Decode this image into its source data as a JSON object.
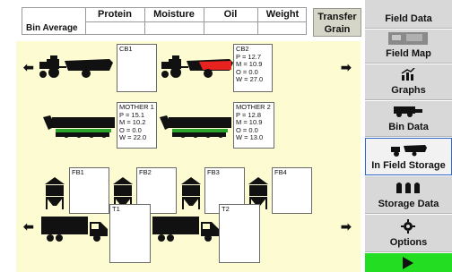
{
  "bin_average": {
    "headers": [
      "Protein",
      "Moisture",
      "Oil",
      "Weight"
    ],
    "row_label": "Bin Average",
    "values": [
      "",
      "",
      "",
      ""
    ]
  },
  "transfer_button": {
    "line1": "Transfer",
    "line2": "Grain"
  },
  "arrows": {
    "left": "⬅",
    "right": "➡"
  },
  "grain_carts": [
    {
      "name": "CB1",
      "lines": [
        "",
        "",
        "",
        ""
      ]
    },
    {
      "name": "CB2",
      "lines": [
        "P = 12.7",
        "M = 10.9",
        "O = 0.0",
        "W = 27.0"
      ]
    }
  ],
  "mother_bins": [
    {
      "name": "MOTHER 1",
      "lines": [
        "P = 15.1",
        "M = 10.2",
        "O = 0.0",
        "W = 22.0"
      ]
    },
    {
      "name": "MOTHER 2",
      "lines": [
        "P = 12.8",
        "M = 10.9",
        "O = 0.0",
        "W = 13.0"
      ]
    }
  ],
  "field_bins": [
    {
      "name": "FB1"
    },
    {
      "name": "FB2"
    },
    {
      "name": "FB3"
    },
    {
      "name": "FB4"
    }
  ],
  "trucks": [
    {
      "name": "T1"
    },
    {
      "name": "T2"
    }
  ],
  "colors": {
    "cart_filled": "#e8231f",
    "nav_active_border": "#2f68c4",
    "play_button": "#22dd22",
    "storage_bg": "#fdfbd2",
    "mother_stripe": "#2aa52a"
  },
  "sidebar": {
    "items": [
      {
        "label": "Field Data",
        "icon": "field-data-icon"
      },
      {
        "label": "Field Map",
        "icon": "field-map-icon"
      },
      {
        "label": "Graphs",
        "icon": "graphs-icon"
      },
      {
        "label": "Bin Data",
        "icon": "combine-icon"
      },
      {
        "label": "In Field Storage",
        "icon": "cart-icon",
        "active": true
      },
      {
        "label": "Storage Data",
        "icon": "silos-icon"
      },
      {
        "label": "Options",
        "icon": "gear-icon"
      }
    ],
    "play_icon": "play-icon"
  }
}
